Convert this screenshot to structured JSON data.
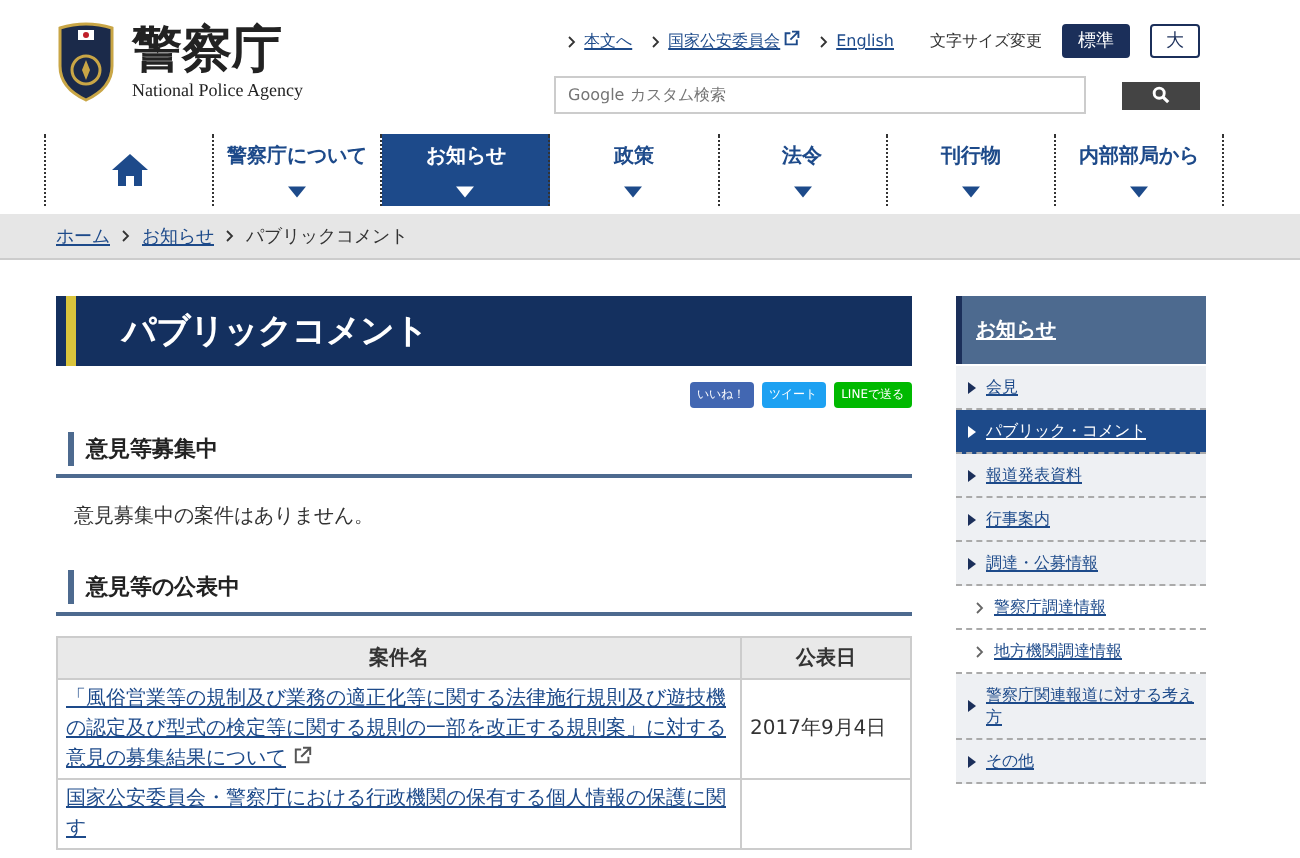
{
  "header": {
    "logo": {
      "title": "警察庁",
      "subtitle": "National Police Agency"
    },
    "utility_links": [
      {
        "label": "本文へ",
        "external": false
      },
      {
        "label": "国家公安委員会",
        "external": true
      },
      {
        "label": "English",
        "external": false
      }
    ],
    "font_size": {
      "label": "文字サイズ変更",
      "options": [
        {
          "label": "標準",
          "selected": true
        },
        {
          "label": "大",
          "selected": false
        }
      ]
    },
    "search": {
      "placeholder": "Google カスタム検索"
    }
  },
  "nav": [
    {
      "kind": "home",
      "selected": false
    },
    {
      "kind": "menu",
      "label": "警察庁について",
      "selected": false
    },
    {
      "kind": "menu",
      "label": "お知らせ",
      "selected": true
    },
    {
      "kind": "menu",
      "label": "政策",
      "selected": false
    },
    {
      "kind": "menu",
      "label": "法令",
      "selected": false
    },
    {
      "kind": "menu",
      "label": "刊行物",
      "selected": false
    },
    {
      "kind": "menu",
      "label": "内部部局から",
      "selected": false
    }
  ],
  "breadcrumb": [
    {
      "label": "ホーム",
      "current": false
    },
    {
      "label": "お知らせ",
      "current": false
    },
    {
      "label": "パブリックコメント",
      "current": true
    }
  ],
  "page_title": "パブリックコメント",
  "social_buttons": [
    {
      "kind": "like",
      "label": "いいね！"
    },
    {
      "kind": "tweet",
      "label": "ツイート"
    },
    {
      "kind": "line",
      "label": "LINEで送る"
    }
  ],
  "sections": [
    {
      "heading": "意見等募集中",
      "text": "意見募集中の案件はありません。"
    },
    {
      "heading": "意見等の公表中",
      "table": {
        "columns": [
          "案件名",
          "公表日"
        ],
        "rows": [
          {
            "title": "「風俗営業等の規制及び業務の適正化等に関する法律施行規則及び遊技機の認定及び型式の検定等に関する規則の一部を改正する規則案」に対する意見の募集結果について",
            "external": true,
            "date": "2017年9月4日"
          },
          {
            "title": "国家公安委員会・警察庁における行政機関の保有する個人情報の保護に関す",
            "external": false
          }
        ]
      }
    }
  ],
  "sidebar": {
    "heading": "お知らせ",
    "items": [
      {
        "label": "会見",
        "selected": false
      },
      {
        "label": "パブリック・コメント",
        "selected": true
      },
      {
        "label": "報道発表資料",
        "selected": false
      },
      {
        "label": "行事案内",
        "selected": false
      },
      {
        "label": "調達・公募情報",
        "selected": false,
        "children": [
          {
            "label": "警察庁調達情報",
            "selected": false
          },
          {
            "label": "地方機関調達情報",
            "selected": false
          }
        ]
      },
      {
        "label": "警察庁関連報道に対する考え方",
        "selected": false
      },
      {
        "label": "その他",
        "selected": false
      }
    ]
  }
}
